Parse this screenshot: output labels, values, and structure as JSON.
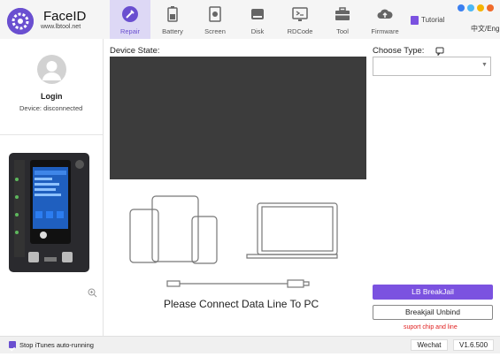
{
  "app": {
    "name": "FaceID",
    "site": "www.lbtool.net"
  },
  "nav": [
    {
      "label": "Repair",
      "icon": "wrench-icon"
    },
    {
      "label": "Battery",
      "icon": "battery-icon"
    },
    {
      "label": "Screen",
      "icon": "screen-icon"
    },
    {
      "label": "Disk",
      "icon": "disk-icon"
    },
    {
      "label": "RDCode",
      "icon": "rdcode-icon"
    },
    {
      "label": "Tool",
      "icon": "toolbox-icon"
    },
    {
      "label": "Firmware",
      "icon": "cloud-upload-icon"
    }
  ],
  "tutorial": "Tutorial",
  "language": "中文/Eng",
  "window_dots": [
    "#3b7ff0",
    "#4bb8f5",
    "#f5b400",
    "#f06a2a"
  ],
  "account": {
    "login": "Login",
    "device_status": "Device: disconnected"
  },
  "main": {
    "device_state_label": "Device State:",
    "choose_type_label": "Choose Type:",
    "type_selected": "",
    "connect_text": "Please Connect Data Line To PC"
  },
  "actions": {
    "lb_breakjail": "LB BreakJail",
    "unbind": "Breakjail Unbind",
    "support_note": "suport chip and line"
  },
  "footer": {
    "stop_itunes": "Stop iTunes auto-running",
    "wechat": "Wechat",
    "version": "V1.6.500"
  },
  "colors": {
    "accent": "#7b52e0",
    "screen": "#3c3c3c",
    "warning": "#e02020"
  }
}
